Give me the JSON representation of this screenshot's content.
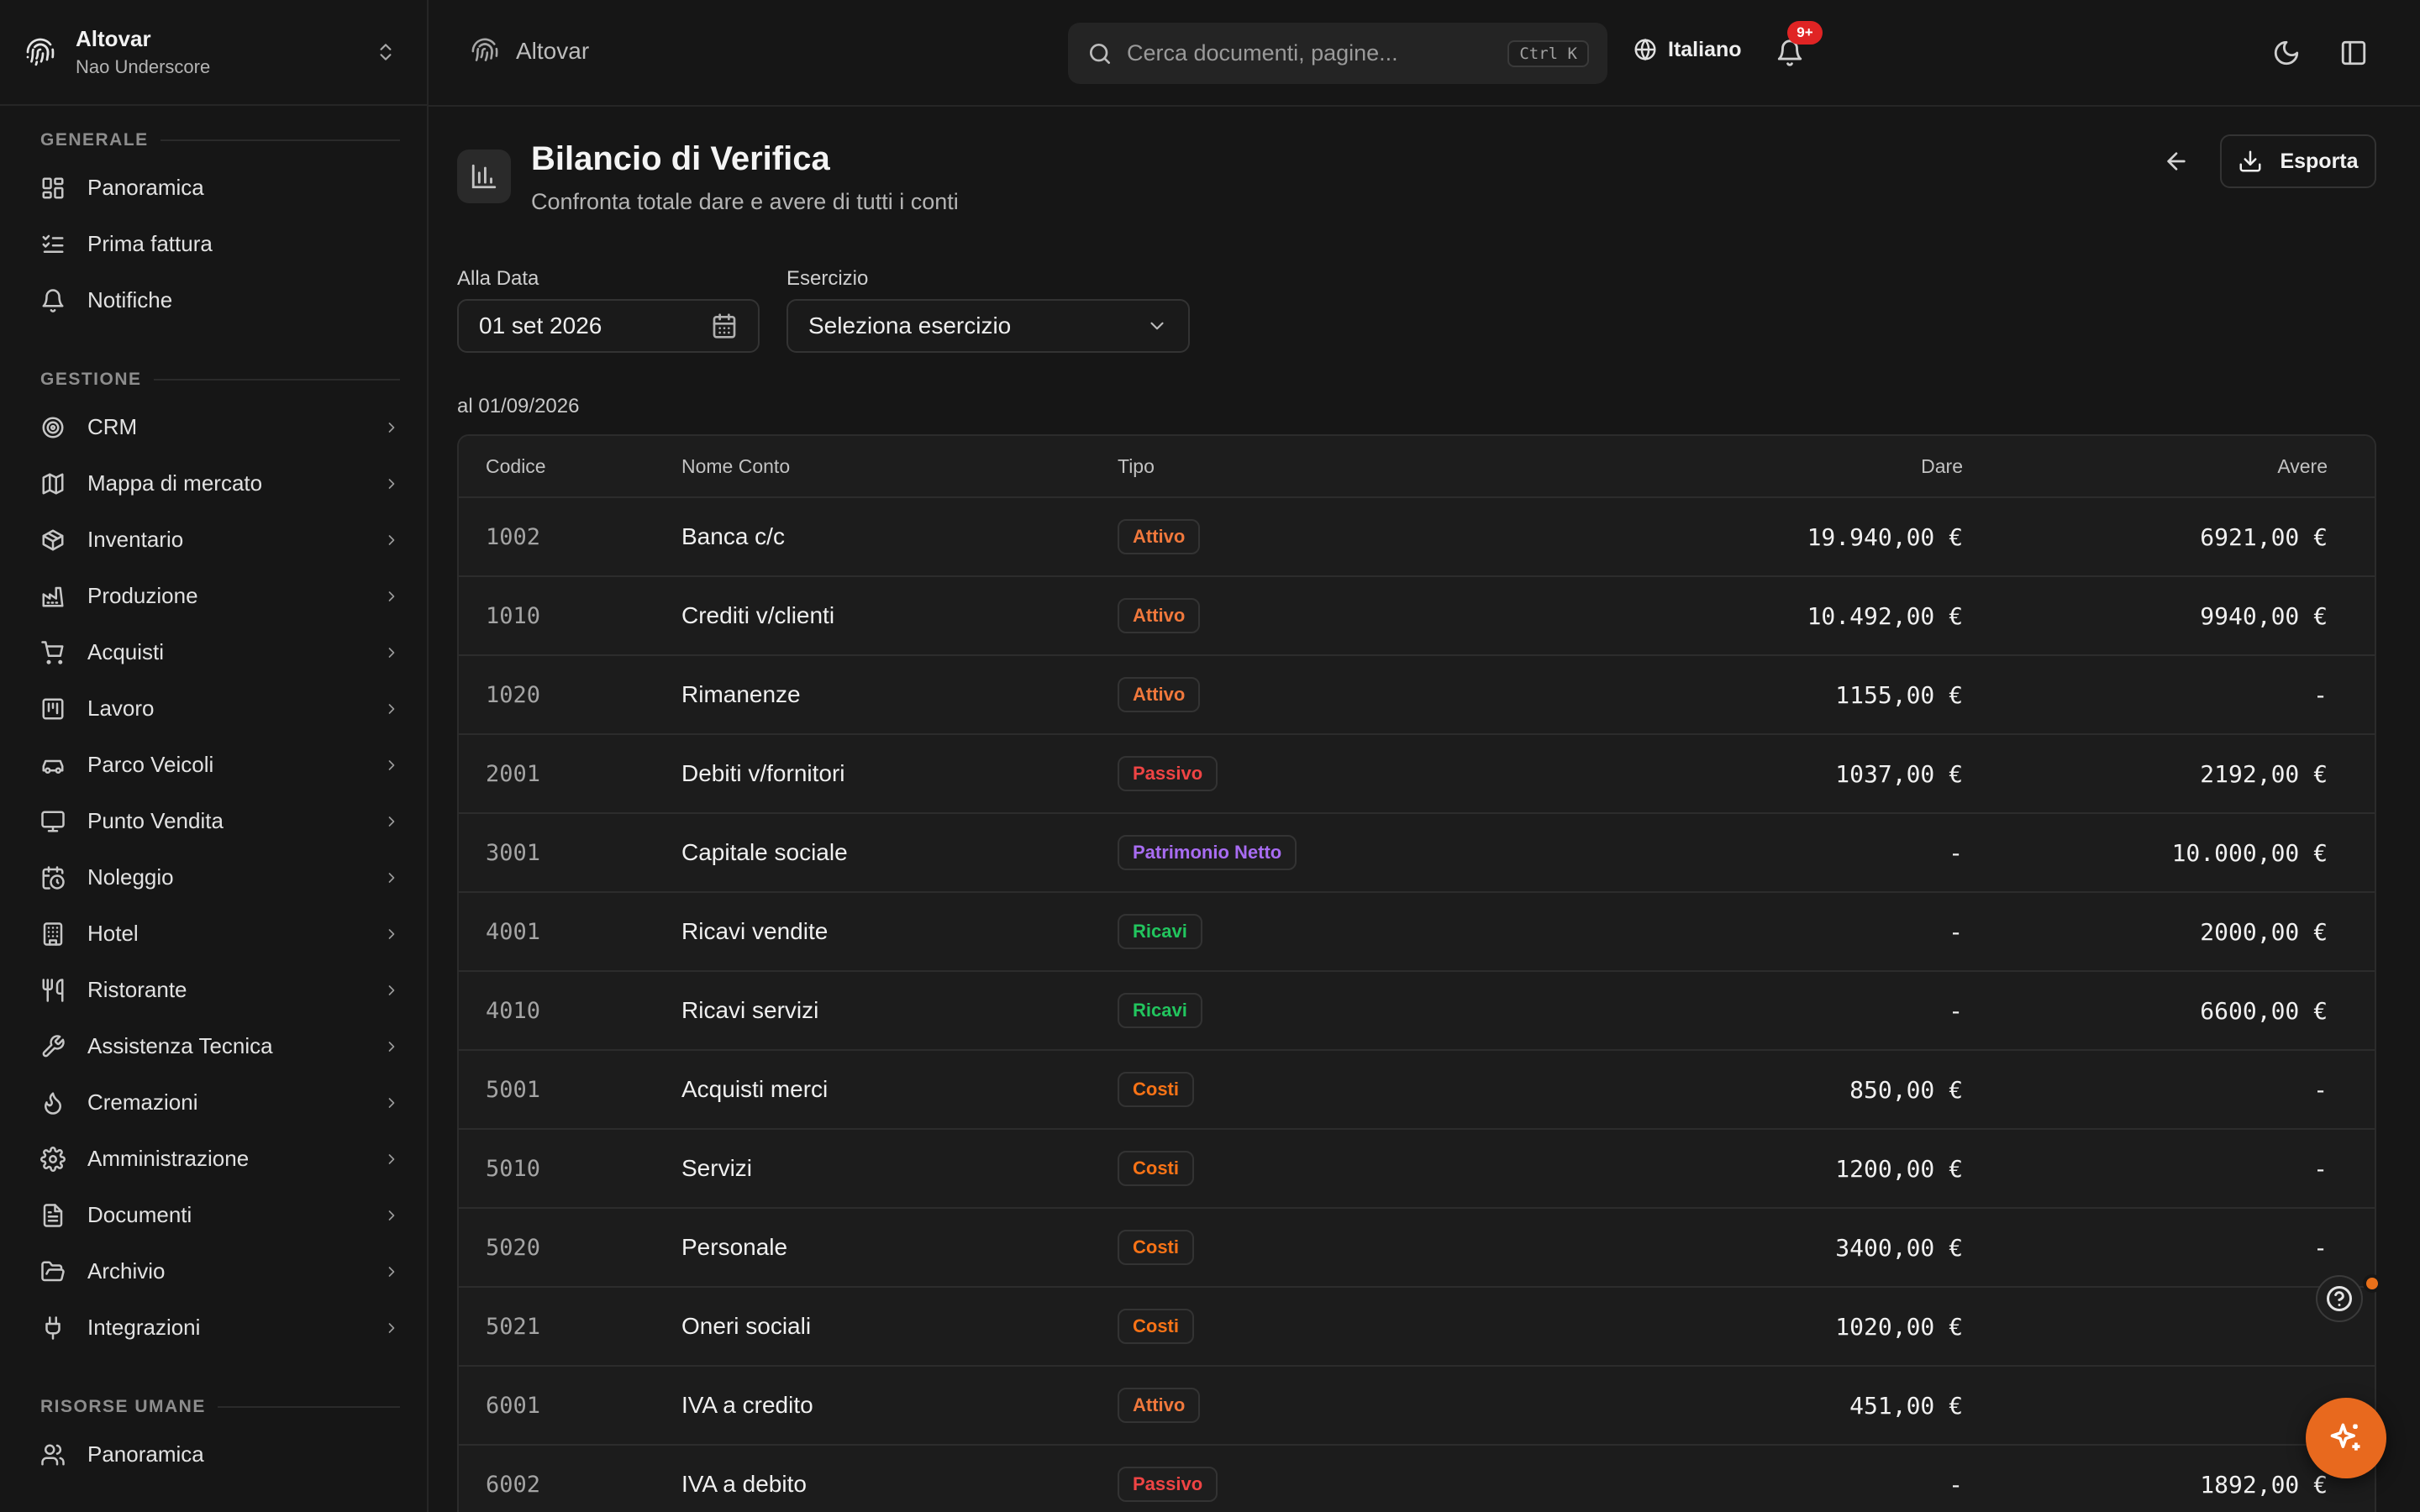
{
  "workspace": {
    "name": "Altovar",
    "user": "Nao Underscore"
  },
  "sidebar": {
    "sections": [
      {
        "title": "GENERALE",
        "items": [
          {
            "label": "Panoramica",
            "icon": "dashboard-icon"
          },
          {
            "label": "Prima fattura",
            "icon": "checklist-icon"
          },
          {
            "label": "Notifiche",
            "icon": "bell-icon"
          }
        ]
      },
      {
        "title": "GESTIONE",
        "items": [
          {
            "label": "CRM",
            "icon": "target-icon"
          },
          {
            "label": "Mappa di mercato",
            "icon": "map-icon"
          },
          {
            "label": "Inventario",
            "icon": "box-icon"
          },
          {
            "label": "Produzione",
            "icon": "factory-icon"
          },
          {
            "label": "Acquisti",
            "icon": "cart-icon"
          },
          {
            "label": "Lavoro",
            "icon": "kanban-icon"
          },
          {
            "label": "Parco Veicoli",
            "icon": "car-icon"
          },
          {
            "label": "Punto Vendita",
            "icon": "monitor-icon"
          },
          {
            "label": "Noleggio",
            "icon": "calendar-clock-icon"
          },
          {
            "label": "Hotel",
            "icon": "building-icon"
          },
          {
            "label": "Ristorante",
            "icon": "utensils-icon"
          },
          {
            "label": "Assistenza Tecnica",
            "icon": "wrench-icon"
          },
          {
            "label": "Cremazioni",
            "icon": "flame-icon"
          },
          {
            "label": "Amministrazione",
            "icon": "gear-icon"
          },
          {
            "label": "Documenti",
            "icon": "file-icon"
          },
          {
            "label": "Archivio",
            "icon": "folder-open-icon"
          },
          {
            "label": "Integrazioni",
            "icon": "plug-icon"
          }
        ]
      },
      {
        "title": "RISORSE UMANE",
        "items": [
          {
            "label": "Panoramica",
            "icon": "users-icon"
          }
        ]
      }
    ]
  },
  "topbar": {
    "breadcrumb": "Altovar",
    "search_placeholder": "Cerca documenti, pagine...",
    "search_shortcut": "Ctrl K",
    "language": "Italiano",
    "notifications_badge": "9+"
  },
  "page": {
    "title": "Bilancio di Verifica",
    "subtitle": "Confronta totale dare e avere di tutti i conti",
    "export_label": "Esporta"
  },
  "filters": {
    "date_label": "Alla Data",
    "date_value": "01 set 2026",
    "fiscal_year_label": "Esercizio",
    "fiscal_year_value": "Seleziona esercizio"
  },
  "as_of": "al 01/09/2026",
  "table": {
    "columns": [
      "Codice",
      "Nome Conto",
      "Tipo",
      "Dare",
      "Avere"
    ],
    "rows": [
      {
        "code": "1002",
        "name": "Banca c/c",
        "type": "Attivo",
        "type_key": "attivo",
        "dare": "19.940,00 €",
        "avere": "6921,00 €"
      },
      {
        "code": "1010",
        "name": "Crediti v/clienti",
        "type": "Attivo",
        "type_key": "attivo",
        "dare": "10.492,00 €",
        "avere": "9940,00 €"
      },
      {
        "code": "1020",
        "name": "Rimanenze",
        "type": "Attivo",
        "type_key": "attivo",
        "dare": "1155,00 €",
        "avere": "-"
      },
      {
        "code": "2001",
        "name": "Debiti v/fornitori",
        "type": "Passivo",
        "type_key": "passivo",
        "dare": "1037,00 €",
        "avere": "2192,00 €"
      },
      {
        "code": "3001",
        "name": "Capitale sociale",
        "type": "Patrimonio Netto",
        "type_key": "patrimonio",
        "dare": "-",
        "avere": "10.000,00 €"
      },
      {
        "code": "4001",
        "name": "Ricavi vendite",
        "type": "Ricavi",
        "type_key": "ricavi",
        "dare": "-",
        "avere": "2000,00 €"
      },
      {
        "code": "4010",
        "name": "Ricavi servizi",
        "type": "Ricavi",
        "type_key": "ricavi",
        "dare": "-",
        "avere": "6600,00 €"
      },
      {
        "code": "5001",
        "name": "Acquisti merci",
        "type": "Costi",
        "type_key": "costi",
        "dare": "850,00 €",
        "avere": "-"
      },
      {
        "code": "5010",
        "name": "Servizi",
        "type": "Costi",
        "type_key": "costi",
        "dare": "1200,00 €",
        "avere": "-"
      },
      {
        "code": "5020",
        "name": "Personale",
        "type": "Costi",
        "type_key": "costi",
        "dare": "3400,00 €",
        "avere": "-"
      },
      {
        "code": "5021",
        "name": "Oneri sociali",
        "type": "Costi",
        "type_key": "costi",
        "dare": "1020,00 €",
        "avere": ""
      },
      {
        "code": "6001",
        "name": "IVA a credito",
        "type": "Attivo",
        "type_key": "attivo",
        "dare": "451,00 €",
        "avere": ""
      },
      {
        "code": "6002",
        "name": "IVA a debito",
        "type": "Passivo",
        "type_key": "passivo",
        "dare": "-",
        "avere": "1892,00 €"
      }
    ]
  },
  "colors": {
    "accent": "#e8691e",
    "attivo": "#f0783c",
    "passivo": "#ef4444",
    "patrimonio": "#a86cf2",
    "ricavi": "#22c55e",
    "costi": "#f97316"
  }
}
